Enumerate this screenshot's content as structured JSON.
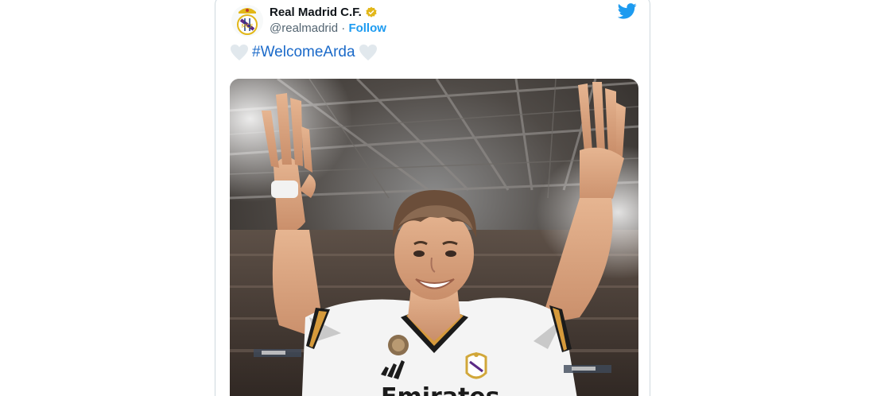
{
  "tweet": {
    "author_name": "Real Madrid C.F.",
    "handle": "@realmadrid",
    "separator": " · ",
    "follow_label": "Follow",
    "hashtag": "#WelcomeArda",
    "avatar_icon": "real-madrid-crest-icon",
    "verified_icon": "verified-gold-badge-icon",
    "brand_icon": "twitter-bird-icon",
    "heart_icon": "white-heart-icon",
    "photo_description_icon": "player-photo",
    "colors": {
      "twitter_blue": "#1d9bf0",
      "hashtag": "#1b6ac9",
      "verified_gold": "#e2b719",
      "heart": "#e1e8ed"
    }
  }
}
